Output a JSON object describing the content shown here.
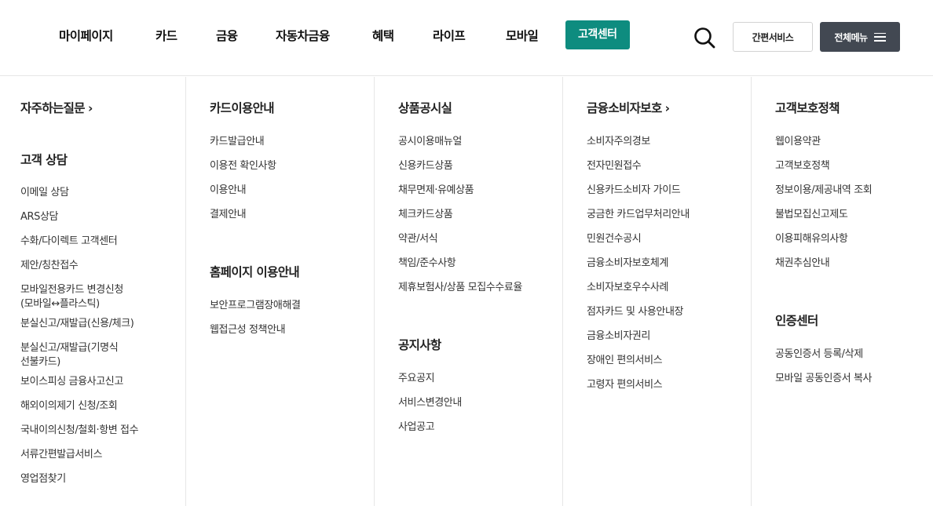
{
  "gnb": {
    "items": [
      "마이페이지",
      "카드",
      "금융",
      "자동차금융",
      "혜택",
      "라이프",
      "모바일",
      "고객센터"
    ],
    "active_index": 7,
    "active_color": "#0e8c7f"
  },
  "header_buttons": {
    "search_icon": "search-icon",
    "simple_service": "간편서비스",
    "all_menu": "전체메뉴",
    "all_menu_bg": "#424852"
  },
  "columns": [
    {
      "sections": [
        {
          "title": "자주하는질문",
          "has_arrow": true,
          "links": []
        },
        {
          "title": "고객 상담",
          "has_arrow": false,
          "links": [
            "이메일 상담",
            "ARS상담",
            "수화/다이렉트 고객센터",
            "제안/칭찬접수",
            "모바일전용카드 변경신청\n(모바일↔플라스틱)",
            "분실신고/재발급(신용/체크)",
            "분실신고/재발급(기명식\n선불카드)",
            "보이스피싱 금융사고신고",
            "해외이의제기 신청/조회",
            "국내이의신청/철회·항변 접수",
            "서류간편발급서비스",
            "영업점찾기"
          ]
        }
      ]
    },
    {
      "sections": [
        {
          "title": "카드이용안내",
          "has_arrow": false,
          "links": [
            "카드발급안내",
            "이용전 확인사항",
            "이용안내",
            "결제안내"
          ]
        },
        {
          "title": "홈페이지 이용안내",
          "has_arrow": false,
          "links": [
            "보안프로그램장애해결",
            "웹접근성 정책안내"
          ]
        }
      ]
    },
    {
      "sections": [
        {
          "title": "상품공시실",
          "has_arrow": false,
          "links": [
            "공시이용매뉴얼",
            "신용카드상품",
            "채무면제·유예상품",
            "체크카드상품",
            "약관/서식",
            "책임/준수사항",
            "제휴보험사/상품 모집수수료율"
          ]
        },
        {
          "title": "공지사항",
          "has_arrow": false,
          "links": [
            "주요공지",
            "서비스변경안내",
            "사업공고"
          ]
        }
      ]
    },
    {
      "sections": [
        {
          "title": "금융소비자보호",
          "has_arrow": true,
          "links": [
            "소비자주의경보",
            "전자민원접수",
            "신용카드소비자 가이드",
            "궁금한 카드업무처리안내",
            "민원건수공시",
            "금융소비자보호체계",
            "소비자보호우수사례",
            "점자카드 및 사용안내장",
            "금융소비자권리",
            "장애인 편의서비스",
            "고령자 편의서비스"
          ]
        }
      ]
    },
    {
      "sections": [
        {
          "title": "고객보호정책",
          "has_arrow": false,
          "links": [
            "웹이용약관",
            "고객보호정책",
            "정보이용/제공내역 조회",
            "불법모집신고제도",
            "이용피해유의사항",
            "채권추심안내"
          ]
        },
        {
          "title": "인증센터",
          "has_arrow": false,
          "links": [
            "공동인증서 등록/삭제",
            "모바일 공동인증서 복사"
          ]
        }
      ]
    }
  ]
}
